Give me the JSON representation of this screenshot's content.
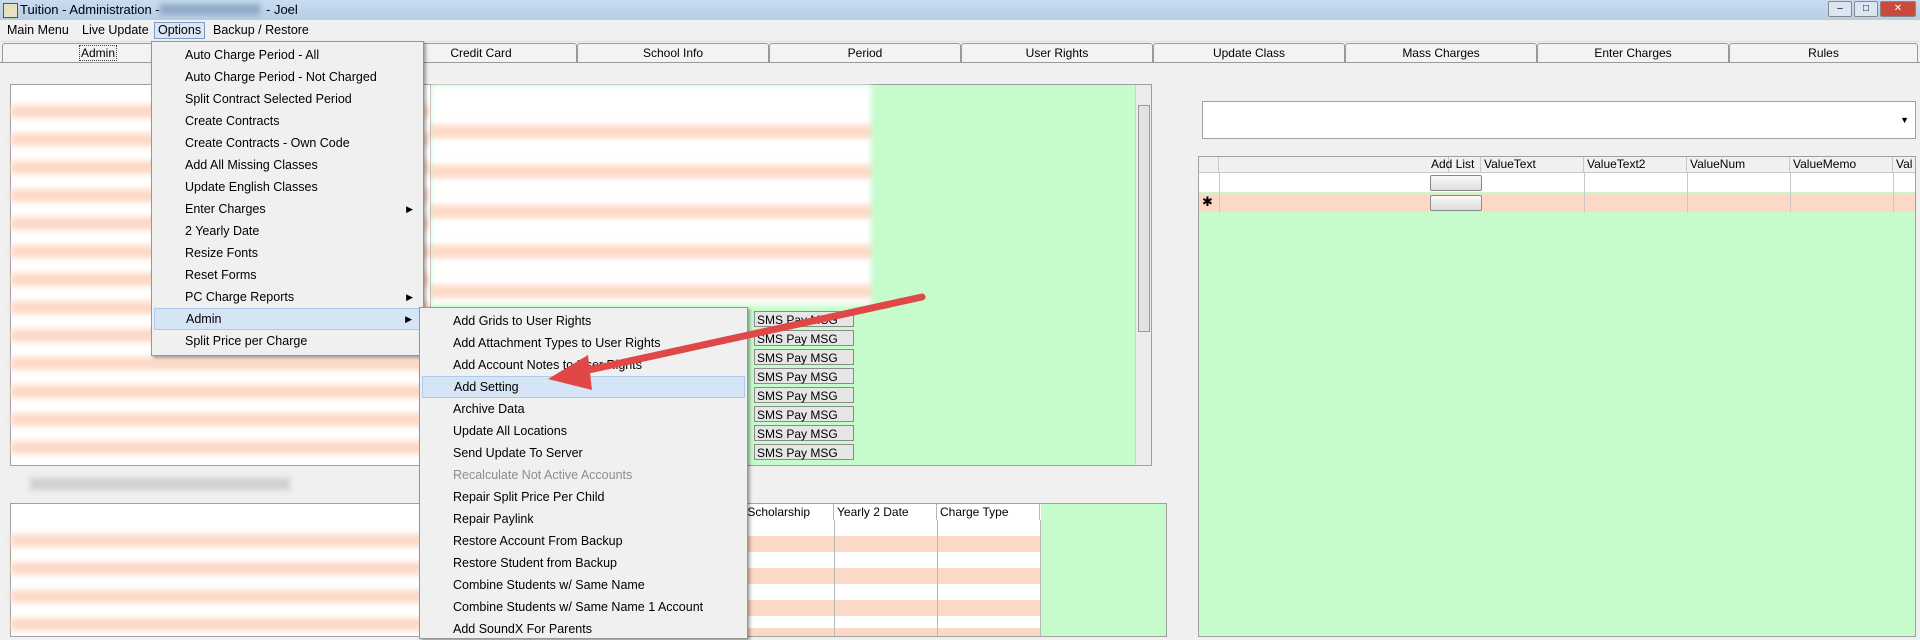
{
  "window": {
    "title": "Tuition - Administration -",
    "user": "- Joel"
  },
  "menubar": [
    "Main Menu",
    "Live Update",
    "Options",
    "Backup / Restore"
  ],
  "tabs": [
    "Admin",
    "Credit Card",
    "School Info",
    "Period",
    "User Rights",
    "Update Class",
    "Mass Charges",
    "Enter Charges",
    "Rules"
  ],
  "options_menu": [
    {
      "label": "Auto Charge Period - All"
    },
    {
      "label": "Auto Charge Period - Not Charged"
    },
    {
      "label": "Split Contract Selected Period"
    },
    {
      "label": "Create Contracts"
    },
    {
      "label": "Create Contracts - Own Code"
    },
    {
      "label": "Add All Missing Classes"
    },
    {
      "label": "Update English Classes"
    },
    {
      "label": "Enter Charges",
      "submenu": true
    },
    {
      "label": "2 Yearly Date"
    },
    {
      "label": "Resize Fonts"
    },
    {
      "label": "Reset Forms"
    },
    {
      "label": "PC Charge Reports",
      "submenu": true
    },
    {
      "label": "Admin",
      "submenu": true
    },
    {
      "label": "Split Price per Charge"
    }
  ],
  "admin_menu": [
    {
      "label": "Add Grids to User Rights"
    },
    {
      "label": "Add Attachment Types to User Rights"
    },
    {
      "label": "Add Account Notes to User Rights"
    },
    {
      "label": "Add Setting"
    },
    {
      "label": "Archive Data"
    },
    {
      "label": "Update All Locations"
    },
    {
      "label": "Send Update To Server"
    },
    {
      "label": "Recalculate Not Active Accounts",
      "disabled": true
    },
    {
      "label": "Repair Split Price Per Child"
    },
    {
      "label": "Repair Paylink"
    },
    {
      "label": "Restore Account From Backup"
    },
    {
      "label": "Restore Student from Backup"
    },
    {
      "label": "Combine Students w/ Same Name"
    },
    {
      "label": "Combine Students w/ Same Name 1 Account"
    },
    {
      "label": "Add SoundX For Parents"
    }
  ],
  "sms_buttons": [
    "SMS Pay MSG",
    "SMS Pay MSG",
    "SMS Pay MSG",
    "SMS Pay MSG",
    "SMS Pay MSG",
    "SMS Pay MSG",
    "SMS Pay MSG",
    "SMS Pay MSG"
  ],
  "settings_grid": {
    "columns": [
      "Add List",
      "ValueText",
      "ValueText2",
      "ValueNum",
      "ValueMemo",
      "Val"
    ],
    "new_row_marker": "✱"
  },
  "bottom_grid": {
    "columns": [
      "m Scholarship",
      "Yearly 2 Date",
      "Charge Type"
    ]
  },
  "colors": {
    "highlight": "#d6e5f5",
    "green_area": "#c6fbcc",
    "pink_row": "#fcd9c6",
    "arrow": "#e04848"
  }
}
